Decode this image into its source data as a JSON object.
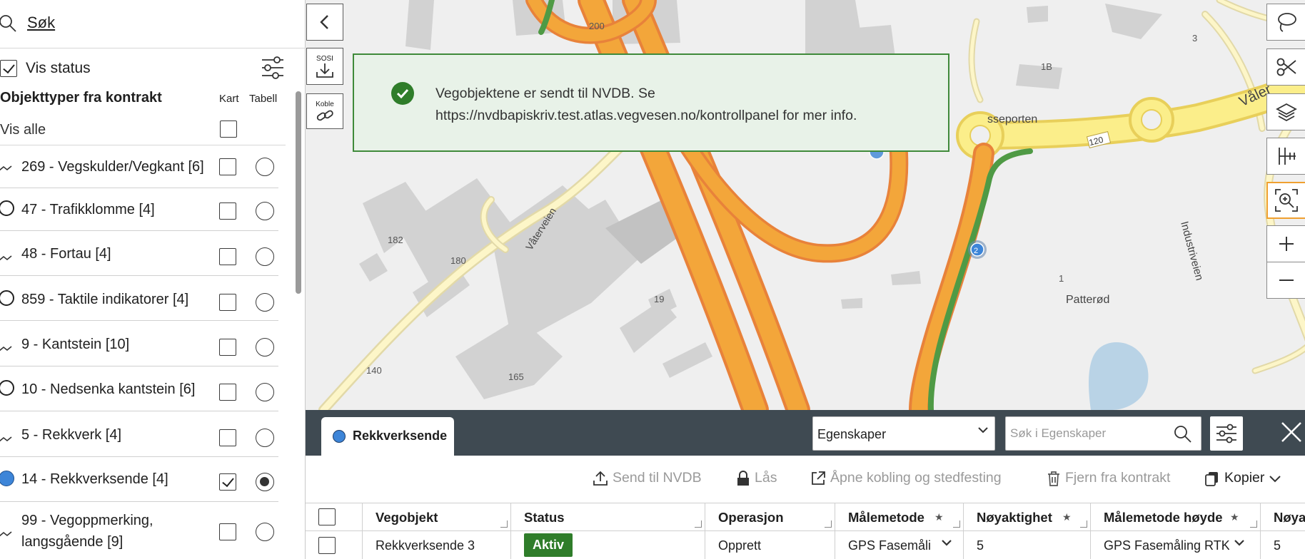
{
  "sidebar": {
    "search_label": "Søk",
    "vis_status": "Vis status",
    "object_types_title": "Objekttyper fra kontrakt",
    "col_kart": "Kart",
    "col_tabell": "Tabell",
    "vis_alle": "Vis alle",
    "items": [
      {
        "label": "269 - Vegskulder/Vegkant [6]",
        "icon": "line-icon",
        "kart": false,
        "tabell": false
      },
      {
        "label": "47 - Trafikklomme [4]",
        "icon": "ring-icon",
        "kart": false,
        "tabell": false
      },
      {
        "label": "48 - Fortau [4]",
        "icon": "line-icon",
        "kart": false,
        "tabell": false
      },
      {
        "label": "859 - Taktile indikatorer [4]",
        "icon": "ring-icon",
        "kart": false,
        "tabell": false
      },
      {
        "label": "9 - Kantstein [10]",
        "icon": "line-icon",
        "kart": false,
        "tabell": false
      },
      {
        "label": "10 - Nedsenka kantstein [6]",
        "icon": "ring-icon",
        "kart": false,
        "tabell": false
      },
      {
        "label": "5 - Rekkverk [4]",
        "icon": "line-icon",
        "kart": false,
        "tabell": false
      },
      {
        "label": "14 - Rekkverksende [4]",
        "icon": "blue-dot-icon",
        "kart": true,
        "tabell": true
      },
      {
        "label": "99 - Vegoppmerking, langsgående [9]",
        "icon": "line-icon",
        "kart": false,
        "tabell": false
      }
    ]
  },
  "map": {
    "labels": {
      "n200": "200",
      "n3": "3",
      "n1b": "1B",
      "sseporten": "sseporten",
      "valer": "Våler",
      "n120": "120",
      "vaterveien": "Våterveien",
      "n182": "182",
      "n180": "180",
      "n19": "19",
      "n140": "140",
      "n165": "165",
      "n1": "1",
      "patterod": "Patterød",
      "industriveien": "Industriveien",
      "marker2": "2"
    },
    "btn_sosi": "SOSI",
    "btn_koble": "Koble"
  },
  "toast": {
    "line1": "Vegobjektene er sendt til NVDB. Se",
    "line2": "https://nvdbapiskriv.test.atlas.vegvesen.no/kontrollpanel for mer info."
  },
  "panel": {
    "tab_label": "Rekkverksende",
    "select_value": "Egenskaper",
    "search_placeholder": "Søk i Egenskaper",
    "actions": {
      "send": "Send til NVDB",
      "las": "Lås",
      "apne": "Åpne kobling og stedfesting",
      "fjern": "Fjern fra kontrakt",
      "kopier": "Kopier"
    },
    "columns": [
      "Vegobjekt",
      "Status",
      "Operasjon",
      "Målemetode",
      "Nøyaktighet",
      "Målemetode høyde",
      "Nøya"
    ],
    "row": {
      "vegobjekt": "Rekkverksende 3",
      "status": "Aktiv",
      "operasjon": "Opprett",
      "malemetode": "GPS Fasemåli",
      "noyaktighet": "5",
      "malemetode_hoyde": "GPS Fasemåling RTK",
      "noya": "5"
    }
  },
  "colors": {
    "accent_green": "#2f7d2a",
    "marker_blue": "#3d85d8",
    "road_orange": "#f3a63a",
    "road_yellow": "#fbee8a",
    "toast_bg": "#e8f2e8"
  }
}
